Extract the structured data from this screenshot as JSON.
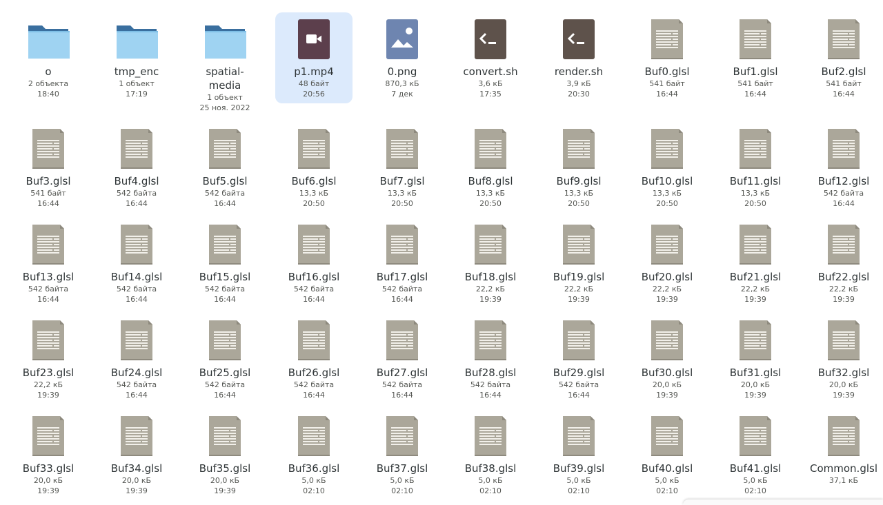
{
  "files": [
    {
      "name": "o",
      "icon": "folder-icon",
      "meta": [
        "2 объекта",
        "18:40"
      ]
    },
    {
      "name": "tmp_enc",
      "icon": "folder-icon",
      "meta": [
        "1 объект",
        "17:19"
      ]
    },
    {
      "name": "spatial-\nmedia",
      "icon": "folder-icon",
      "meta": [
        "1 объект",
        "25 ноя. 2022"
      ]
    },
    {
      "name": "p1.mp4",
      "icon": "video-file-icon",
      "meta": [
        "48 байт",
        "20:56"
      ],
      "selected": true
    },
    {
      "name": "0.png",
      "icon": "image-file-icon",
      "meta": [
        "870,3 кБ",
        "7 дек"
      ]
    },
    {
      "name": "convert.sh",
      "icon": "script-file-icon",
      "meta": [
        "3,6 кБ",
        "17:35"
      ]
    },
    {
      "name": "render.sh",
      "icon": "script-file-icon",
      "meta": [
        "3,9 кБ",
        "20:30"
      ]
    },
    {
      "name": "Buf0.glsl",
      "icon": "text-file-icon",
      "meta": [
        "541 байт",
        "16:44"
      ]
    },
    {
      "name": "Buf1.glsl",
      "icon": "text-file-icon",
      "meta": [
        "541 байт",
        "16:44"
      ]
    },
    {
      "name": "Buf2.glsl",
      "icon": "text-file-icon",
      "meta": [
        "541 байт",
        "16:44"
      ]
    },
    {
      "name": "Buf3.glsl",
      "icon": "text-file-icon",
      "meta": [
        "541 байт",
        "16:44"
      ]
    },
    {
      "name": "Buf4.glsl",
      "icon": "text-file-icon",
      "meta": [
        "542 байта",
        "16:44"
      ]
    },
    {
      "name": "Buf5.glsl",
      "icon": "text-file-icon",
      "meta": [
        "542 байта",
        "16:44"
      ]
    },
    {
      "name": "Buf6.glsl",
      "icon": "text-file-icon",
      "meta": [
        "13,3 кБ",
        "20:50"
      ]
    },
    {
      "name": "Buf7.glsl",
      "icon": "text-file-icon",
      "meta": [
        "13,3 кБ",
        "20:50"
      ]
    },
    {
      "name": "Buf8.glsl",
      "icon": "text-file-icon",
      "meta": [
        "13,3 кБ",
        "20:50"
      ]
    },
    {
      "name": "Buf9.glsl",
      "icon": "text-file-icon",
      "meta": [
        "13,3 кБ",
        "20:50"
      ]
    },
    {
      "name": "Buf10.glsl",
      "icon": "text-file-icon",
      "meta": [
        "13,3 кБ",
        "20:50"
      ]
    },
    {
      "name": "Buf11.glsl",
      "icon": "text-file-icon",
      "meta": [
        "13,3 кБ",
        "20:50"
      ]
    },
    {
      "name": "Buf12.glsl",
      "icon": "text-file-icon",
      "meta": [
        "542 байта",
        "16:44"
      ]
    },
    {
      "name": "Buf13.glsl",
      "icon": "text-file-icon",
      "meta": [
        "542 байта",
        "16:44"
      ]
    },
    {
      "name": "Buf14.glsl",
      "icon": "text-file-icon",
      "meta": [
        "542 байта",
        "16:44"
      ]
    },
    {
      "name": "Buf15.glsl",
      "icon": "text-file-icon",
      "meta": [
        "542 байта",
        "16:44"
      ]
    },
    {
      "name": "Buf16.glsl",
      "icon": "text-file-icon",
      "meta": [
        "542 байта",
        "16:44"
      ]
    },
    {
      "name": "Buf17.glsl",
      "icon": "text-file-icon",
      "meta": [
        "542 байта",
        "16:44"
      ]
    },
    {
      "name": "Buf18.glsl",
      "icon": "text-file-icon",
      "meta": [
        "22,2 кБ",
        "19:39"
      ]
    },
    {
      "name": "Buf19.glsl",
      "icon": "text-file-icon",
      "meta": [
        "22,2 кБ",
        "19:39"
      ]
    },
    {
      "name": "Buf20.glsl",
      "icon": "text-file-icon",
      "meta": [
        "22,2 кБ",
        "19:39"
      ]
    },
    {
      "name": "Buf21.glsl",
      "icon": "text-file-icon",
      "meta": [
        "22,2 кБ",
        "19:39"
      ]
    },
    {
      "name": "Buf22.glsl",
      "icon": "text-file-icon",
      "meta": [
        "22,2 кБ",
        "19:39"
      ]
    },
    {
      "name": "Buf23.glsl",
      "icon": "text-file-icon",
      "meta": [
        "22,2 кБ",
        "19:39"
      ]
    },
    {
      "name": "Buf24.glsl",
      "icon": "text-file-icon",
      "meta": [
        "542 байта",
        "16:44"
      ]
    },
    {
      "name": "Buf25.glsl",
      "icon": "text-file-icon",
      "meta": [
        "542 байта",
        "16:44"
      ]
    },
    {
      "name": "Buf26.glsl",
      "icon": "text-file-icon",
      "meta": [
        "542 байта",
        "16:44"
      ]
    },
    {
      "name": "Buf27.glsl",
      "icon": "text-file-icon",
      "meta": [
        "542 байта",
        "16:44"
      ]
    },
    {
      "name": "Buf28.glsl",
      "icon": "text-file-icon",
      "meta": [
        "542 байта",
        "16:44"
      ]
    },
    {
      "name": "Buf29.glsl",
      "icon": "text-file-icon",
      "meta": [
        "542 байта",
        "16:44"
      ]
    },
    {
      "name": "Buf30.glsl",
      "icon": "text-file-icon",
      "meta": [
        "20,0 кБ",
        "19:39"
      ]
    },
    {
      "name": "Buf31.glsl",
      "icon": "text-file-icon",
      "meta": [
        "20,0 кБ",
        "19:39"
      ]
    },
    {
      "name": "Buf32.glsl",
      "icon": "text-file-icon",
      "meta": [
        "20,0 кБ",
        "19:39"
      ]
    },
    {
      "name": "Buf33.glsl",
      "icon": "text-file-icon",
      "meta": [
        "20,0 кБ",
        "19:39"
      ]
    },
    {
      "name": "Buf34.glsl",
      "icon": "text-file-icon",
      "meta": [
        "20,0 кБ",
        "19:39"
      ]
    },
    {
      "name": "Buf35.glsl",
      "icon": "text-file-icon",
      "meta": [
        "20,0 кБ",
        "19:39"
      ]
    },
    {
      "name": "Buf36.glsl",
      "icon": "text-file-icon",
      "meta": [
        "5,0 кБ",
        "02:10"
      ]
    },
    {
      "name": "Buf37.glsl",
      "icon": "text-file-icon",
      "meta": [
        "5,0 кБ",
        "02:10"
      ]
    },
    {
      "name": "Buf38.glsl",
      "icon": "text-file-icon",
      "meta": [
        "5,0 кБ",
        "02:10"
      ]
    },
    {
      "name": "Buf39.glsl",
      "icon": "text-file-icon",
      "meta": [
        "5,0 кБ",
        "02:10"
      ]
    },
    {
      "name": "Buf40.glsl",
      "icon": "text-file-icon",
      "meta": [
        "5,0 кБ",
        "02:10"
      ]
    },
    {
      "name": "Buf41.glsl",
      "icon": "text-file-icon",
      "meta": [
        "5,0 кБ",
        "02:10"
      ]
    },
    {
      "name": "Common.glsl",
      "icon": "text-file-icon",
      "meta": [
        "37,1 кБ"
      ]
    }
  ],
  "colors": {
    "selection": "#dceafc",
    "folder_back": "#3a6f9f",
    "folder_front": "#9fd3f2",
    "text_file": "#aba79a",
    "video_file": "#5c3f4c",
    "image_file": "#6e85b0",
    "script_file": "#5e524b"
  }
}
